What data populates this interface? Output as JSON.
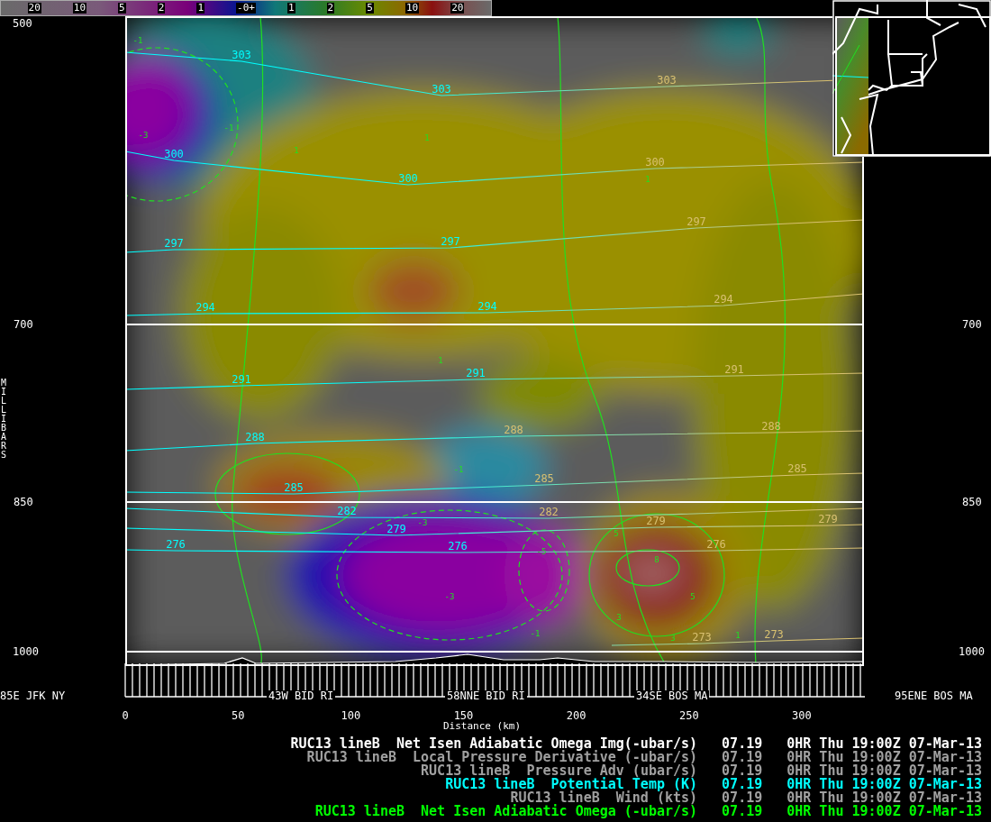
{
  "colorbar": {
    "labels": [
      "20",
      "10",
      "5",
      "2",
      "1",
      "-0+",
      "1",
      "2",
      "5",
      "10",
      "20"
    ]
  },
  "y_axis": {
    "title": "MILLIBARS",
    "left_ticks": [
      "500",
      "700",
      "850",
      "1000"
    ],
    "right_ticks": [
      "700",
      "850",
      "1000"
    ]
  },
  "x_axis": {
    "title": "Distance (km)",
    "ticks": [
      "0",
      "50",
      "100",
      "150",
      "200",
      "250",
      "300"
    ]
  },
  "section": {
    "start": "85E JFK NY",
    "end": "95ENE BOS MA",
    "waypoints": [
      "43W BID RI",
      "58NNE BID RI",
      "34SE BOS MA"
    ]
  },
  "isentropes": [
    {
      "labels": [
        "303",
        "303",
        "303"
      ]
    },
    {
      "labels": [
        "300",
        "300",
        "300"
      ]
    },
    {
      "labels": [
        "297",
        "297",
        "297"
      ]
    },
    {
      "labels": [
        "294",
        "294",
        "294"
      ]
    },
    {
      "labels": [
        "291",
        "291",
        "291"
      ]
    },
    {
      "labels": [
        "288",
        "288",
        "288"
      ]
    },
    {
      "labels": [
        "285",
        "285",
        "285"
      ]
    },
    {
      "labels": [
        "282",
        "282"
      ]
    },
    {
      "labels": [
        "279",
        "279",
        "279"
      ]
    },
    {
      "labels": [
        "276",
        "276",
        "276"
      ]
    },
    {
      "labels": [
        "273",
        "273"
      ]
    }
  ],
  "omega_labels": [
    "-1",
    "-1",
    "-3",
    "1",
    "1",
    "1",
    "1",
    "-1",
    "-3",
    "-3",
    "-5",
    "5",
    "8",
    "5",
    "3",
    "3",
    "-1",
    "1"
  ],
  "legend": [
    {
      "title": "RUC13 lineB  Net Isen Adiabatic Omega Img(-ubar/s)",
      "version": "07.19",
      "valid": "0HR Thu 19:00Z 07-Mar-13",
      "color": "#ffffff"
    },
    {
      "title": "RUC13 lineB  Local Pressure Derivative (-ubar/s)",
      "version": "07.19",
      "valid": "0HR Thu 19:00Z 07-Mar-13",
      "color": "#a0a0a0"
    },
    {
      "title": "RUC13 lineB  Pressure Adv (ubar/s)",
      "version": "07.19",
      "valid": "0HR Thu 19:00Z 07-Mar-13",
      "color": "#a0a0a0"
    },
    {
      "title": "RUC13 lineB  Potential Temp (K)",
      "version": "07.19",
      "valid": "0HR Thu 19:00Z 07-Mar-13",
      "color": "#00ffff"
    },
    {
      "title": "RUC13 lineB  Wind (kts)",
      "version": "07.19",
      "valid": "0HR Thu 19:00Z 07-Mar-13",
      "color": "#a0a0a0"
    },
    {
      "title": "RUC13 lineB  Net Isen Adiabatic Omega (-ubar/s)",
      "version": "07.19",
      "valid": "0HR Thu 19:00Z 07-Mar-13",
      "color": "#00ff00"
    }
  ]
}
